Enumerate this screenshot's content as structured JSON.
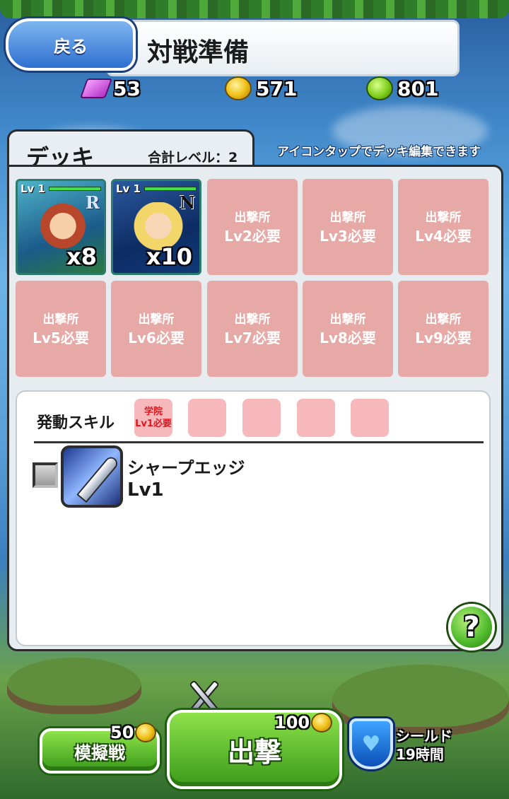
{
  "header": {
    "back_label": "戻る",
    "title": "対戦準備"
  },
  "currencies": [
    {
      "icon": "gem-icon",
      "value": "53"
    },
    {
      "icon": "coin-icon",
      "value": "571"
    },
    {
      "icon": "leaf-icon",
      "value": "801"
    }
  ],
  "deck": {
    "title": "デッキ",
    "total_level": "合計レベル：2",
    "hint": "アイコンタップでデッキ編集できます",
    "units": [
      {
        "level": "Lv 1",
        "rank": "R",
        "count": "x8"
      },
      {
        "level": "Lv 1",
        "rank": "N",
        "count": "x10"
      }
    ],
    "locked_slots": [
      {
        "building": "出撃所",
        "req": "Lv2必要"
      },
      {
        "building": "出撃所",
        "req": "Lv3必要"
      },
      {
        "building": "出撃所",
        "req": "Lv4必要"
      },
      {
        "building": "出撃所",
        "req": "Lv5必要"
      },
      {
        "building": "出撃所",
        "req": "Lv6必要"
      },
      {
        "building": "出撃所",
        "req": "Lv7必要"
      },
      {
        "building": "出撃所",
        "req": "Lv8必要"
      },
      {
        "building": "出撃所",
        "req": "Lv9必要"
      }
    ]
  },
  "skills": {
    "label": "発動スキル",
    "first_slot": {
      "line1": "学院",
      "line2": "Lv1必要"
    },
    "item": {
      "name": "シャープエッジ",
      "level": "Lv1",
      "checked": false
    },
    "help_label": "?"
  },
  "bottom": {
    "mock_battle_label": "模擬戦",
    "mock_battle_cost": "50",
    "sortie_label": "出撃",
    "sortie_cost": "100",
    "shield_label": "シールド",
    "shield_time": "19時間"
  }
}
